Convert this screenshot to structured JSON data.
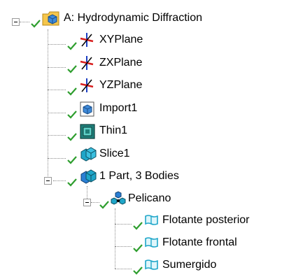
{
  "tree": {
    "root": {
      "label": "A: Hydrodynamic Diffraction",
      "icon": "geometry-folder-icon",
      "expanded": true
    },
    "items": [
      {
        "label": "XYPlane",
        "icon": "plane-axes-icon"
      },
      {
        "label": "ZXPlane",
        "icon": "plane-axes-icon"
      },
      {
        "label": "YZPlane",
        "icon": "plane-axes-icon"
      },
      {
        "label": "Import1",
        "icon": "import-icon"
      },
      {
        "label": "Thin1",
        "icon": "thin-icon"
      },
      {
        "label": "Slice1",
        "icon": "slice-icon"
      },
      {
        "label": "1 Part, 3 Bodies",
        "icon": "parts-icon",
        "expanded": true
      }
    ],
    "part": {
      "label": "Pelicano",
      "icon": "part-group-icon",
      "expanded": true
    },
    "bodies": [
      {
        "label": "Flotante posterior",
        "icon": "surface-body-icon"
      },
      {
        "label": "Flotante frontal",
        "icon": "surface-body-icon"
      },
      {
        "label": "Sumergido",
        "icon": "surface-body-icon"
      }
    ]
  },
  "colors": {
    "check": "#2e9e2e",
    "tree_line": "#8c8c8c",
    "axis_red": "#d81e1e",
    "axis_blue": "#1c3fc4",
    "cube_blue": "#2a7fd4",
    "surface_cyan": "#1fa6c9"
  }
}
